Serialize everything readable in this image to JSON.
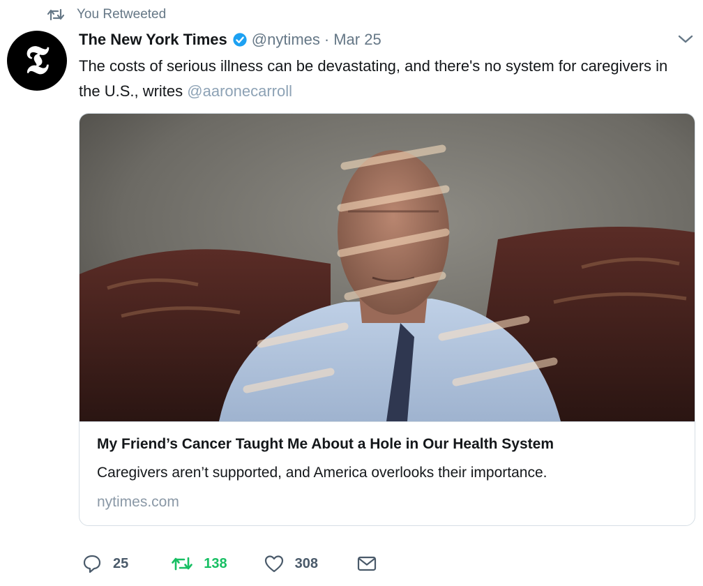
{
  "retweet_context": {
    "label": "You Retweeted",
    "icon": "retweet-icon"
  },
  "tweet": {
    "avatar": {
      "glyph": "𝕿",
      "icon": "nyt-logo"
    },
    "author_name": "The New York Times",
    "verified_icon": "verified-badge-icon",
    "handle": "@nytimes",
    "separator": "·",
    "date": "Mar 25",
    "text": "The costs of serious illness can be devastating, and there's no system for caregivers in the U.S., writes ",
    "mention": "@aaronecarroll",
    "menu_icon": "chevron-down-icon"
  },
  "card": {
    "title": "My Friend’s Cancer Taught Me About a Hole in Our Health System",
    "description": "Caregivers aren’t supported, and America overlooks their importance.",
    "domain": "nytimes.com"
  },
  "actions": {
    "replies": "25",
    "retweets": "138",
    "likes": "308",
    "icons": [
      "reply-icon",
      "retweet-icon",
      "like-icon",
      "dm-icon"
    ]
  },
  "colors": {
    "text": "#14171a",
    "secondary": "#657786",
    "verified": "#1da1f2",
    "retweet_active": "#17bf63",
    "mention": "#8da2b5"
  }
}
